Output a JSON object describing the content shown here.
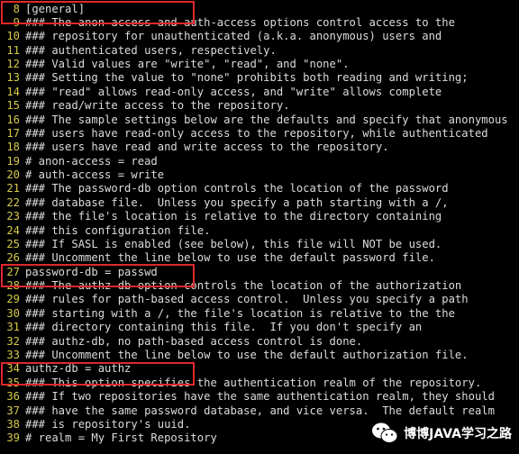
{
  "colors": {
    "background": "#000000",
    "line_number": "#d6c94a",
    "text": "#dcdcdc",
    "highlight_box": "#e0282b"
  },
  "lines": [
    {
      "num": "8",
      "text": "[general]"
    },
    {
      "num": "9",
      "text": "### The anon-access and auth-access options control access to the"
    },
    {
      "num": "10",
      "text": "### repository for unauthenticated (a.k.a. anonymous) users and"
    },
    {
      "num": "11",
      "text": "### authenticated users, respectively."
    },
    {
      "num": "12",
      "text": "### Valid values are \"write\", \"read\", and \"none\"."
    },
    {
      "num": "13",
      "text": "### Setting the value to \"none\" prohibits both reading and writing;"
    },
    {
      "num": "14",
      "text": "### \"read\" allows read-only access, and \"write\" allows complete"
    },
    {
      "num": "15",
      "text": "### read/write access to the repository."
    },
    {
      "num": "16",
      "text": "### The sample settings below are the defaults and specify that anonymous"
    },
    {
      "num": "17",
      "text": "### users have read-only access to the repository, while authenticated"
    },
    {
      "num": "18",
      "text": "### users have read and write access to the repository."
    },
    {
      "num": "19",
      "text": "# anon-access = read"
    },
    {
      "num": "20",
      "text": "# auth-access = write"
    },
    {
      "num": "21",
      "text": "### The password-db option controls the location of the password"
    },
    {
      "num": "22",
      "text": "### database file.  Unless you specify a path starting with a /,"
    },
    {
      "num": "23",
      "text": "### the file's location is relative to the directory containing"
    },
    {
      "num": "24",
      "text": "### this configuration file."
    },
    {
      "num": "25",
      "text": "### If SASL is enabled (see below), this file will NOT be used."
    },
    {
      "num": "26",
      "text": "### Uncomment the line below to use the default password file."
    },
    {
      "num": "27",
      "text": "password-db = passwd"
    },
    {
      "num": "28",
      "text": "### The authz-db option controls the location of the authorization"
    },
    {
      "num": "29",
      "text": "### rules for path-based access control.  Unless you specify a path"
    },
    {
      "num": "30",
      "text": "### starting with a /, the file's location is relative to the the"
    },
    {
      "num": "31",
      "text": "### directory containing this file.  If you don't specify an"
    },
    {
      "num": "32",
      "text": "### authz-db, no path-based access control is done."
    },
    {
      "num": "33",
      "text": "### Uncomment the line below to use the default authorization file."
    },
    {
      "num": "34",
      "text": "authz-db = authz"
    },
    {
      "num": "35",
      "text": "### This option specifies the authentication realm of the repository."
    },
    {
      "num": "36",
      "text": "### If two repositories have the same authentication realm, they should"
    },
    {
      "num": "37",
      "text": "### have the same password database, and vice versa.  The default realm"
    },
    {
      "num": "38",
      "text": "### is repository's uuid."
    },
    {
      "num": "39",
      "text": "# realm = My First Repository"
    }
  ],
  "watermark": {
    "icon": "wechat-icon",
    "text": "博博JAVA学习之路"
  }
}
